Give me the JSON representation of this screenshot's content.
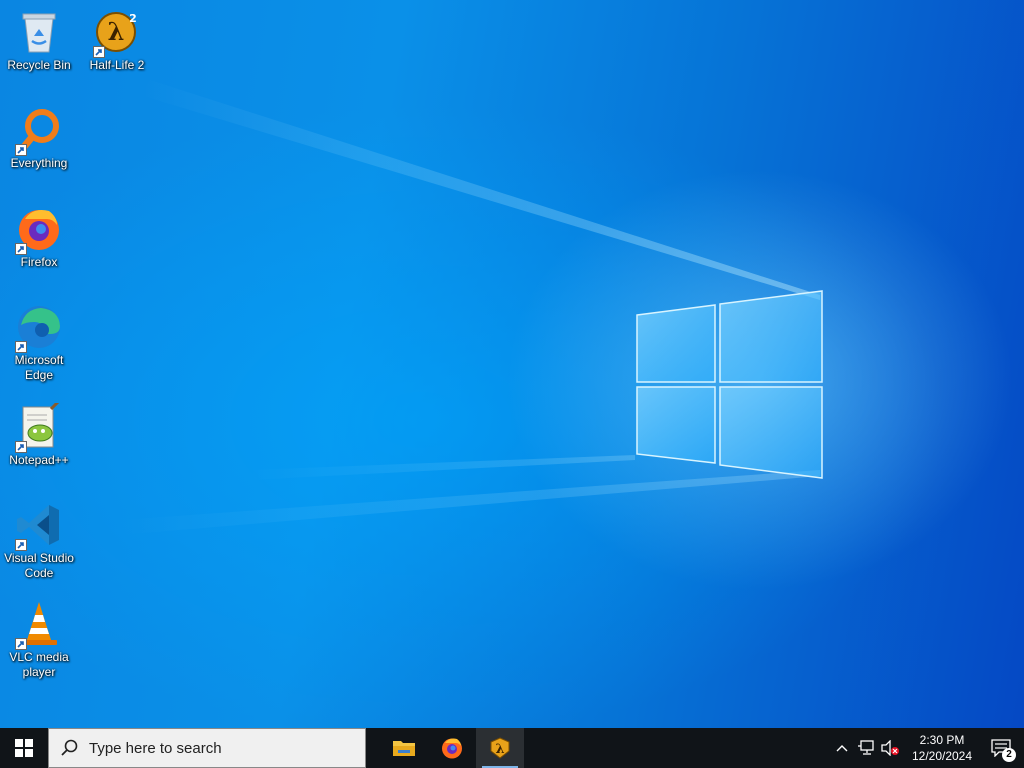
{
  "desktop": {
    "icons": [
      {
        "label": "Recycle Bin",
        "icon": "recycle-bin-icon",
        "shortcut": false
      },
      {
        "label": "Half-Life 2",
        "icon": "half-life-2-icon",
        "shortcut": true
      },
      {
        "label": "Everything",
        "icon": "everything-search-icon",
        "shortcut": true
      },
      {
        "label": "Firefox",
        "icon": "firefox-icon",
        "shortcut": true
      },
      {
        "label": "Microsoft\nEdge",
        "icon": "edge-icon",
        "shortcut": true
      },
      {
        "label": "Notepad++",
        "icon": "notepad-plus-plus-icon",
        "shortcut": true
      },
      {
        "label": "Visual Studio\nCode",
        "icon": "vscode-icon",
        "shortcut": true
      },
      {
        "label": "VLC media\nplayer",
        "icon": "vlc-icon",
        "shortcut": true
      }
    ]
  },
  "taskbar": {
    "search_placeholder": "Type here to search",
    "apps": [
      {
        "name": "File Explorer",
        "icon": "folder-icon"
      },
      {
        "name": "Firefox",
        "icon": "firefox-icon"
      },
      {
        "name": "Half-Life 2",
        "icon": "half-life-2-icon"
      }
    ],
    "tray": {
      "time": "2:30 PM",
      "date": "12/20/2024",
      "notification_count": "2"
    }
  },
  "colors": {
    "taskbar": "#101418",
    "accent": "#0a86e2"
  }
}
